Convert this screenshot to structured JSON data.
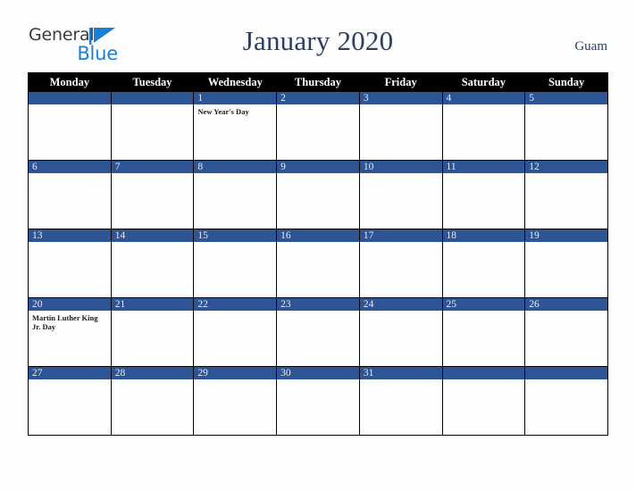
{
  "brand": {
    "name_line1": "General",
    "name_line2": "Blue",
    "triangle_icon": "triangle-right-icon",
    "color_dark": "#3b3b3b",
    "color_blue": "#1b7fd4"
  },
  "header": {
    "title": "January 2020",
    "locale": "Guam"
  },
  "colors": {
    "date_bar": "#2d5494",
    "weekday_header_bg": "#000000",
    "weekday_header_text": "#ffffff",
    "title_text": "#2b3f66",
    "page_background": "#fdfdfd",
    "grid_border": "#000000"
  },
  "calendar": {
    "month": "January",
    "year": "2020",
    "weekdays": [
      "Monday",
      "Tuesday",
      "Wednesday",
      "Thursday",
      "Friday",
      "Saturday",
      "Sunday"
    ],
    "weeks": [
      [
        {
          "day": "",
          "holiday": ""
        },
        {
          "day": "",
          "holiday": ""
        },
        {
          "day": "1",
          "holiday": "New Year's Day"
        },
        {
          "day": "2",
          "holiday": ""
        },
        {
          "day": "3",
          "holiday": ""
        },
        {
          "day": "4",
          "holiday": ""
        },
        {
          "day": "5",
          "holiday": ""
        }
      ],
      [
        {
          "day": "6",
          "holiday": ""
        },
        {
          "day": "7",
          "holiday": ""
        },
        {
          "day": "8",
          "holiday": ""
        },
        {
          "day": "9",
          "holiday": ""
        },
        {
          "day": "10",
          "holiday": ""
        },
        {
          "day": "11",
          "holiday": ""
        },
        {
          "day": "12",
          "holiday": ""
        }
      ],
      [
        {
          "day": "13",
          "holiday": ""
        },
        {
          "day": "14",
          "holiday": ""
        },
        {
          "day": "15",
          "holiday": ""
        },
        {
          "day": "16",
          "holiday": ""
        },
        {
          "day": "17",
          "holiday": ""
        },
        {
          "day": "18",
          "holiday": ""
        },
        {
          "day": "19",
          "holiday": ""
        }
      ],
      [
        {
          "day": "20",
          "holiday": "Martin Luther King Jr. Day"
        },
        {
          "day": "21",
          "holiday": ""
        },
        {
          "day": "22",
          "holiday": ""
        },
        {
          "day": "23",
          "holiday": ""
        },
        {
          "day": "24",
          "holiday": ""
        },
        {
          "day": "25",
          "holiday": ""
        },
        {
          "day": "26",
          "holiday": ""
        }
      ],
      [
        {
          "day": "27",
          "holiday": ""
        },
        {
          "day": "28",
          "holiday": ""
        },
        {
          "day": "29",
          "holiday": ""
        },
        {
          "day": "30",
          "holiday": ""
        },
        {
          "day": "31",
          "holiday": ""
        },
        {
          "day": "",
          "holiday": ""
        },
        {
          "day": "",
          "holiday": ""
        }
      ]
    ]
  }
}
